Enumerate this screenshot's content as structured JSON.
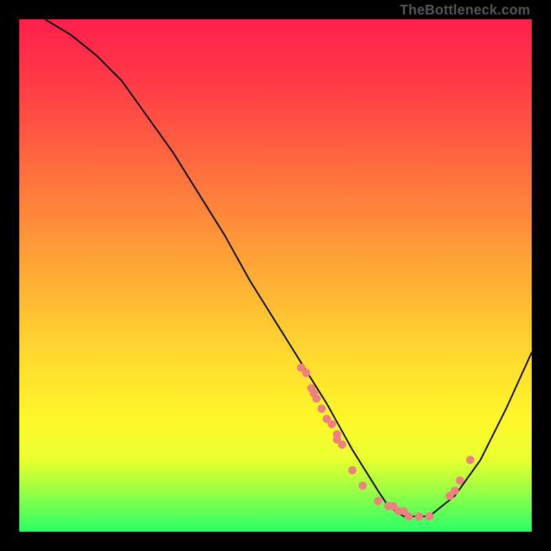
{
  "watermark": "TheBottleneck.com",
  "chart_data": {
    "type": "line",
    "title": "",
    "xlabel": "",
    "ylabel": "",
    "xlim": [
      0,
      100
    ],
    "ylim": [
      0,
      100
    ],
    "grid": false,
    "legend": false,
    "series": [
      {
        "name": "curve",
        "style": "line",
        "color": "#000000",
        "x": [
          5,
          10,
          15,
          20,
          25,
          30,
          35,
          40,
          45,
          50,
          55,
          60,
          65,
          70,
          72,
          75,
          80,
          85,
          90,
          95,
          100
        ],
        "y": [
          100,
          97,
          93,
          88,
          81,
          74,
          66,
          58,
          49,
          41,
          33,
          25,
          16,
          8,
          5,
          3,
          3,
          7,
          14,
          24,
          35
        ]
      },
      {
        "name": "dots",
        "style": "scatter",
        "color": "#ef8080",
        "x": [
          55,
          56,
          57,
          57.5,
          58,
          59,
          60,
          61,
          62,
          62,
          63,
          65,
          67,
          70,
          72,
          73,
          74,
          75,
          76,
          78,
          80,
          84,
          85,
          86,
          88
        ],
        "y": [
          32,
          31,
          28,
          27,
          26,
          24,
          22,
          21,
          19,
          18,
          17,
          12,
          9,
          6,
          5,
          5,
          4,
          4,
          3,
          3,
          3,
          7,
          8,
          10,
          14
        ]
      }
    ]
  }
}
